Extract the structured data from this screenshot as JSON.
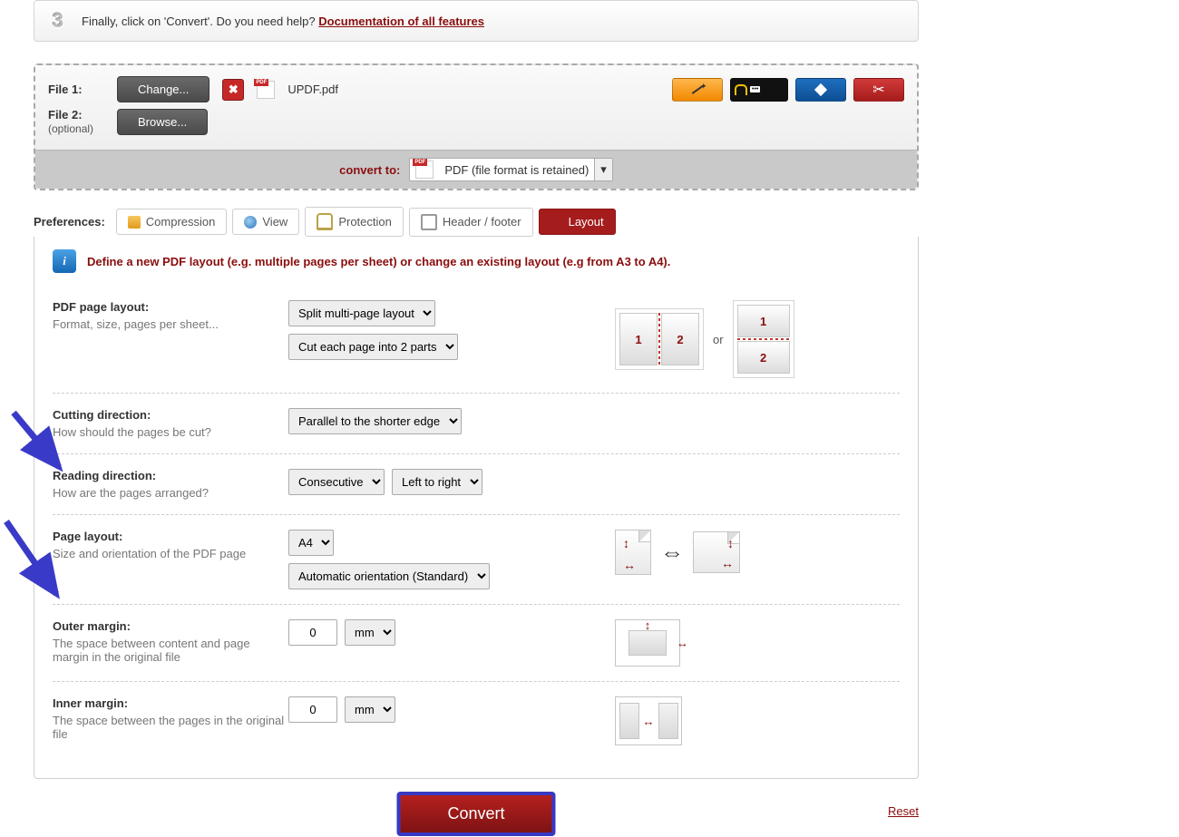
{
  "step": {
    "num": "3",
    "text_a": "Finally, click on 'Convert'. Do you need help? ",
    "link": "Documentation of all features"
  },
  "files": {
    "label1": "File 1:",
    "label2": "File 2:",
    "optional": "(optional)",
    "change": "Change...",
    "browse": "Browse...",
    "filename": "UPDF.pdf"
  },
  "tools": {
    "wand": "magic",
    "lock": "password",
    "rotate": "rotate",
    "cut": "cut"
  },
  "convert": {
    "label": "convert to:",
    "value": "PDF (file format is retained)"
  },
  "prefs_label": "Preferences:",
  "tabs": {
    "compression": "Compression",
    "view": "View",
    "protection": "Protection",
    "header": "Header / footer",
    "layout": "Layout"
  },
  "info": "Define a new PDF layout (e.g. multiple pages per sheet) or change an existing layout (e.g from A3 to A4).",
  "opt_layout": {
    "t": "PDF page layout:",
    "d": "Format, size, pages per sheet...",
    "sel1": "Split multi-page layout",
    "sel2": "Cut each page into 2 parts"
  },
  "diag": {
    "p1": "1",
    "p2": "2",
    "or": "or"
  },
  "opt_cut": {
    "t": "Cutting direction:",
    "d": "How should the pages be cut?",
    "sel": "Parallel to the shorter edge"
  },
  "opt_read": {
    "t": "Reading direction:",
    "d": "How are the pages arranged?",
    "sel1": "Consecutive",
    "sel2": "Left to right"
  },
  "opt_page": {
    "t": "Page layout:",
    "d": "Size and orientation of the PDF page",
    "sel1": "A4",
    "sel2": "Automatic orientation (Standard)"
  },
  "opt_outer": {
    "t": "Outer margin:",
    "d": "The space between content and page margin in the original file",
    "val": "0",
    "unit": "mm"
  },
  "opt_inner": {
    "t": "Inner margin:",
    "d": "The space between the pages in the original file",
    "val": "0",
    "unit": "mm"
  },
  "footer": {
    "convert": "Convert",
    "reset": "Reset"
  }
}
